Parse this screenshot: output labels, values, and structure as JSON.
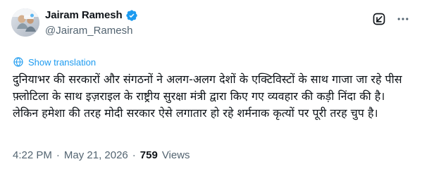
{
  "post": {
    "author": {
      "display_name": "Jairam Ramesh",
      "handle": "@Jairam_Ramesh",
      "verified": true,
      "avatar_icon": "avatar-photo-icon"
    },
    "header_actions": {
      "grok_icon": "grok-icon",
      "more_icon": "more-icon"
    },
    "show_translation": "Show translation",
    "text": "दुनियाभर की सरकारों और संगठनों ने अलग-अलग देशों के एक्टिविस्टों के साथ गाजा जा रहे पीस फ़्लोटिला के साथ इज़राइल के राष्ट्रीय सुरक्षा मंत्री द्वारा किए गए व्यवहार की कड़ी निंदा की है। लेकिन हमेशा की तरह मोदी सरकार ऐसे लगातार हो रहे शर्मनाक कृत्यों पर पूरी तरह चुप है।",
    "time": "4:22 PM",
    "date": "May 21, 2026",
    "views_count": "759",
    "views_label": "Views",
    "separator": "·"
  },
  "colors": {
    "text": "#0f1419",
    "secondary": "#536471",
    "accent": "#1d9bf0",
    "background": "#ffffff"
  }
}
